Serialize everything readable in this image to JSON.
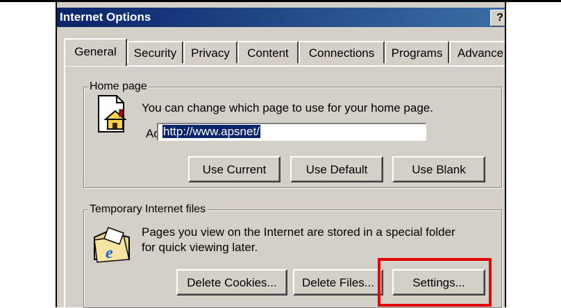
{
  "window": {
    "title": "Internet Options",
    "help_label": "?"
  },
  "tabs": [
    {
      "label": "General",
      "active": true
    },
    {
      "label": "Security",
      "active": false
    },
    {
      "label": "Privacy",
      "active": false
    },
    {
      "label": "Content",
      "active": false
    },
    {
      "label": "Connections",
      "active": false
    },
    {
      "label": "Programs",
      "active": false
    },
    {
      "label": "Advance",
      "active": false
    }
  ],
  "home_page": {
    "group_label": "Home page",
    "icon": "home-page-icon",
    "description": "You can change which page to use for your home page.",
    "address_label": "Address:",
    "address_value": "http://www.apsnet/",
    "buttons": {
      "use_current": "Use Current",
      "use_default": "Use Default",
      "use_blank": "Use Blank"
    }
  },
  "temp_files": {
    "group_label": "Temporary Internet files",
    "icon": "ie-folder-icon",
    "description_line1": "Pages you view on the Internet are stored in a special folder",
    "description_line2": "for quick viewing later.",
    "buttons": {
      "delete_cookies": "Delete Cookies...",
      "delete_files": "Delete Files...",
      "settings": "Settings..."
    }
  },
  "colors": {
    "title_start": "#0a246a",
    "title_end": "#3a6ea5",
    "dialog_bg": "#d4d0c8",
    "selection": "#0a246a",
    "highlight_box": "#e00000"
  }
}
